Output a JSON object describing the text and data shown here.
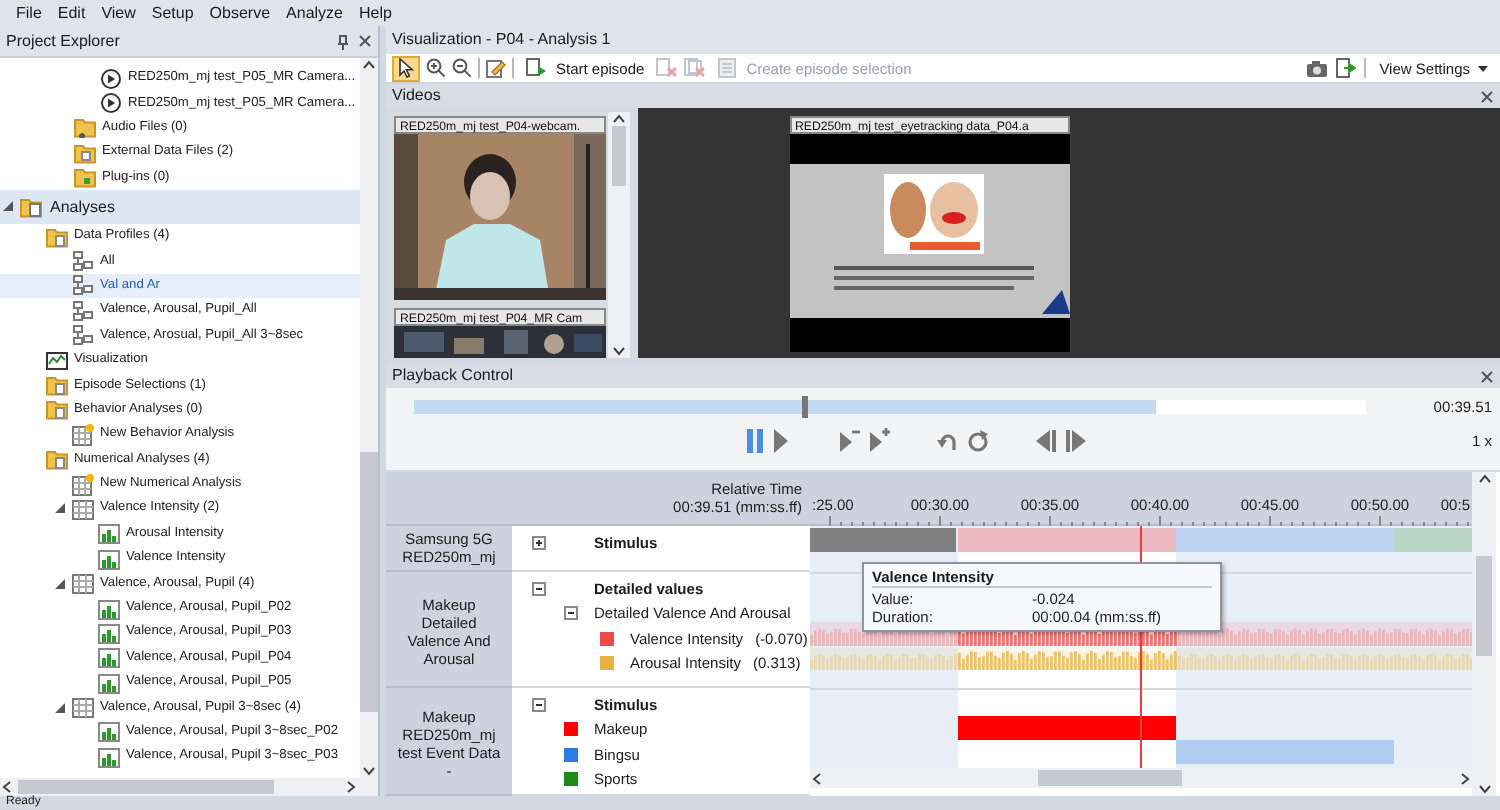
{
  "menu": [
    "File",
    "Edit",
    "View",
    "Setup",
    "Observe",
    "Analyze",
    "Help"
  ],
  "project_explorer": {
    "title": "Project Explorer",
    "upper_items": [
      {
        "kind": "video",
        "label": "RED250m_mj test_P05_MR Camera...",
        "selected": false
      },
      {
        "kind": "video",
        "label": "RED250m_mj test_P05_MR Camera...",
        "selected": false
      },
      {
        "kind": "audio",
        "label": "Audio Files (0)",
        "selected": false
      },
      {
        "kind": "data",
        "label": "External Data Files (2)",
        "selected": false
      },
      {
        "kind": "plugin",
        "label": "Plug-ins (0)",
        "selected": false
      }
    ],
    "items": [
      {
        "kind": "section",
        "label": "Analyses",
        "expanded": true,
        "selected": false,
        "children": [
          {
            "kind": "folder",
            "label": "Data Profiles (4)",
            "selected": false,
            "children": [
              {
                "kind": "profile",
                "label": "All",
                "selected": false
              },
              {
                "kind": "profile",
                "label": "Val and Ar",
                "selected": true
              },
              {
                "kind": "profile",
                "label": "Valence, Arousal, Pupil_All",
                "selected": false
              },
              {
                "kind": "profile",
                "label": "Valence, Arosual, Pupil_All 3~8sec",
                "selected": false
              }
            ]
          },
          {
            "kind": "visualization",
            "label": "Visualization",
            "selected": false
          },
          {
            "kind": "folder",
            "label": "Episode Selections (1)",
            "selected": false
          },
          {
            "kind": "folder",
            "label": "Behavior Analyses (0)",
            "selected": false,
            "children": [
              {
                "kind": "new",
                "label": "New Behavior Analysis",
                "selected": false
              }
            ]
          },
          {
            "kind": "folder",
            "label": "Numerical Analyses (4)",
            "selected": false,
            "children": [
              {
                "kind": "new",
                "label": "New Numerical Analysis",
                "selected": false
              },
              {
                "kind": "analysis",
                "label": "Valence Intensity (2)",
                "expanded": true,
                "selected": false,
                "children": [
                  {
                    "kind": "chart",
                    "label": "Arousal Intensity",
                    "selected": false
                  },
                  {
                    "kind": "chart",
                    "label": "Valence Intensity",
                    "selected": false
                  }
                ]
              },
              {
                "kind": "analysis",
                "label": "Valence, Arousal, Pupil (4)",
                "expanded": true,
                "selected": false,
                "children": [
                  {
                    "kind": "chart",
                    "label": "Valence, Arousal, Pupil_P02",
                    "selected": false
                  },
                  {
                    "kind": "chart",
                    "label": "Valence, Arousal, Pupil_P03",
                    "selected": false
                  },
                  {
                    "kind": "chart",
                    "label": "Valence, Arousal, Pupil_P04",
                    "selected": false
                  },
                  {
                    "kind": "chart",
                    "label": "Valence, Arousal, Pupil_P05",
                    "selected": false
                  }
                ]
              },
              {
                "kind": "analysis",
                "label": "Valence, Arousal, Pupil 3~8sec (4)",
                "expanded": true,
                "selected": false,
                "children": [
                  {
                    "kind": "chart",
                    "label": "Valence, Arousal, Pupil 3~8sec_P02",
                    "selected": false
                  },
                  {
                    "kind": "chart",
                    "label": "Valence, Arousal, Pupil 3~8sec_P03",
                    "selected": false
                  }
                ]
              }
            ]
          }
        ]
      }
    ]
  },
  "visualization": {
    "title": "Visualization - P04 - Analysis 1",
    "toolbar": {
      "pointer_selected": true,
      "start_episode": "Start episode",
      "create_selection": {
        "label": "Create episode selection",
        "disabled": true
      },
      "view_settings": "View Settings"
    },
    "videos": {
      "title": "Videos",
      "thumbnails": [
        {
          "label": "RED250m_mj test_P04-webcam."
        },
        {
          "label": "RED250m_mj test_P04_MR Cam"
        }
      ],
      "main": {
        "label": "RED250m_mj test_eyetracking data_P04.a"
      }
    },
    "playback": {
      "title": "Playback Control",
      "position": {
        "level": 0.41
      },
      "range": {
        "level": 0.78
      },
      "time": "00:39.51",
      "speed": "1 x",
      "paused": true
    },
    "timeline": {
      "header_label": "Relative Time",
      "current_time": "00:39.51 (mm:ss.ff)",
      "ticks": [
        ":25.00",
        "00:30.00",
        "00:35.00",
        "00:40.00",
        "00:45.00",
        "00:50.00",
        "00:5"
      ],
      "groups": [
        {
          "label": "Samsung 5G RED250m_mj",
          "rows": [
            {
              "kind": "header",
              "label": "Stimulus",
              "expanded": false
            }
          ]
        },
        {
          "label": "Makeup Detailed Valence And Arousal",
          "rows": [
            {
              "kind": "header",
              "label": "Detailed values",
              "expanded": true
            },
            {
              "kind": "subheader",
              "label": "Detailed Valence And Arousal",
              "expanded": true
            },
            {
              "kind": "series",
              "label": "Valence Intensity",
              "value": "(-0.070)",
              "color": "#f04848"
            },
            {
              "kind": "series",
              "label": "Arousal Intensity",
              "value": "(0.313)",
              "color": "#e8b040"
            }
          ]
        },
        {
          "label": "Makeup RED250m_mj test Event Data -",
          "rows": [
            {
              "kind": "header",
              "label": "Stimulus",
              "expanded": true
            },
            {
              "kind": "event",
              "label": "Makeup",
              "color": "#ff0000"
            },
            {
              "kind": "event",
              "label": "Bingsu",
              "color": "#2a7de1"
            },
            {
              "kind": "event",
              "label": "Sports",
              "color": "#1a8a1a"
            }
          ]
        }
      ],
      "tooltip": {
        "title": "Valence Intensity",
        "rows": [
          {
            "label": "Value:",
            "value": "-0.024"
          },
          {
            "label": "Duration:",
            "value": "00:00.04 (mm:ss.ff)"
          }
        ]
      }
    }
  },
  "status_bar": "Ready"
}
